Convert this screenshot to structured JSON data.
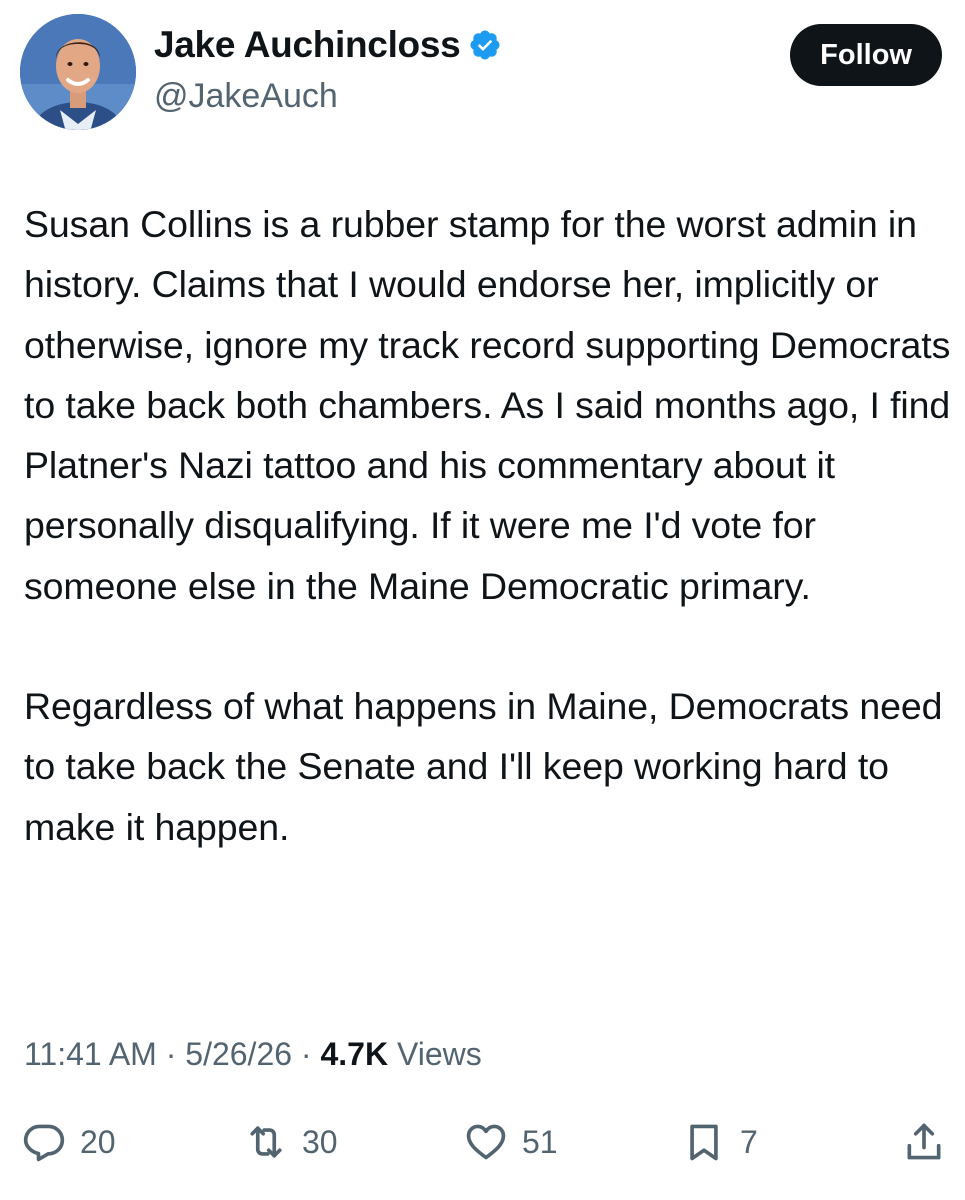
{
  "author": {
    "display_name": "Jake Auchincloss",
    "handle": "@JakeAuch",
    "verified": true
  },
  "follow_button": {
    "label": "Follow"
  },
  "tweet": {
    "paragraphs": [
      "Susan Collins is a rubber stamp for the worst admin in history. Claims that I would endorse her, implicitly or otherwise, ignore my track record supporting Democrats to take back both chambers. As I said months ago, I find Platner's Nazi tattoo and his commentary about it personally disqualifying. If it were me I'd vote for someone else in the Maine Democratic primary.",
      "Regardless of what happens in Maine, Democrats need to take back the Senate and I'll keep working hard to make it happen."
    ]
  },
  "meta": {
    "time": "11:41 AM",
    "separator": "·",
    "date": "5/26/26",
    "views_count": "4.7K",
    "views_label": "Views"
  },
  "actions": {
    "reply": {
      "icon": "reply-icon",
      "count": "20"
    },
    "repost": {
      "icon": "repost-icon",
      "count": "30"
    },
    "like": {
      "icon": "heart-icon",
      "count": "51"
    },
    "bookmark": {
      "icon": "bookmark-icon",
      "count": "7"
    },
    "share": {
      "icon": "share-icon"
    }
  },
  "colors": {
    "text_primary": "#0f1419",
    "text_secondary": "#536471",
    "verified_blue": "#1d9bf0",
    "follow_bg": "#0f1419",
    "follow_text": "#ffffff"
  }
}
